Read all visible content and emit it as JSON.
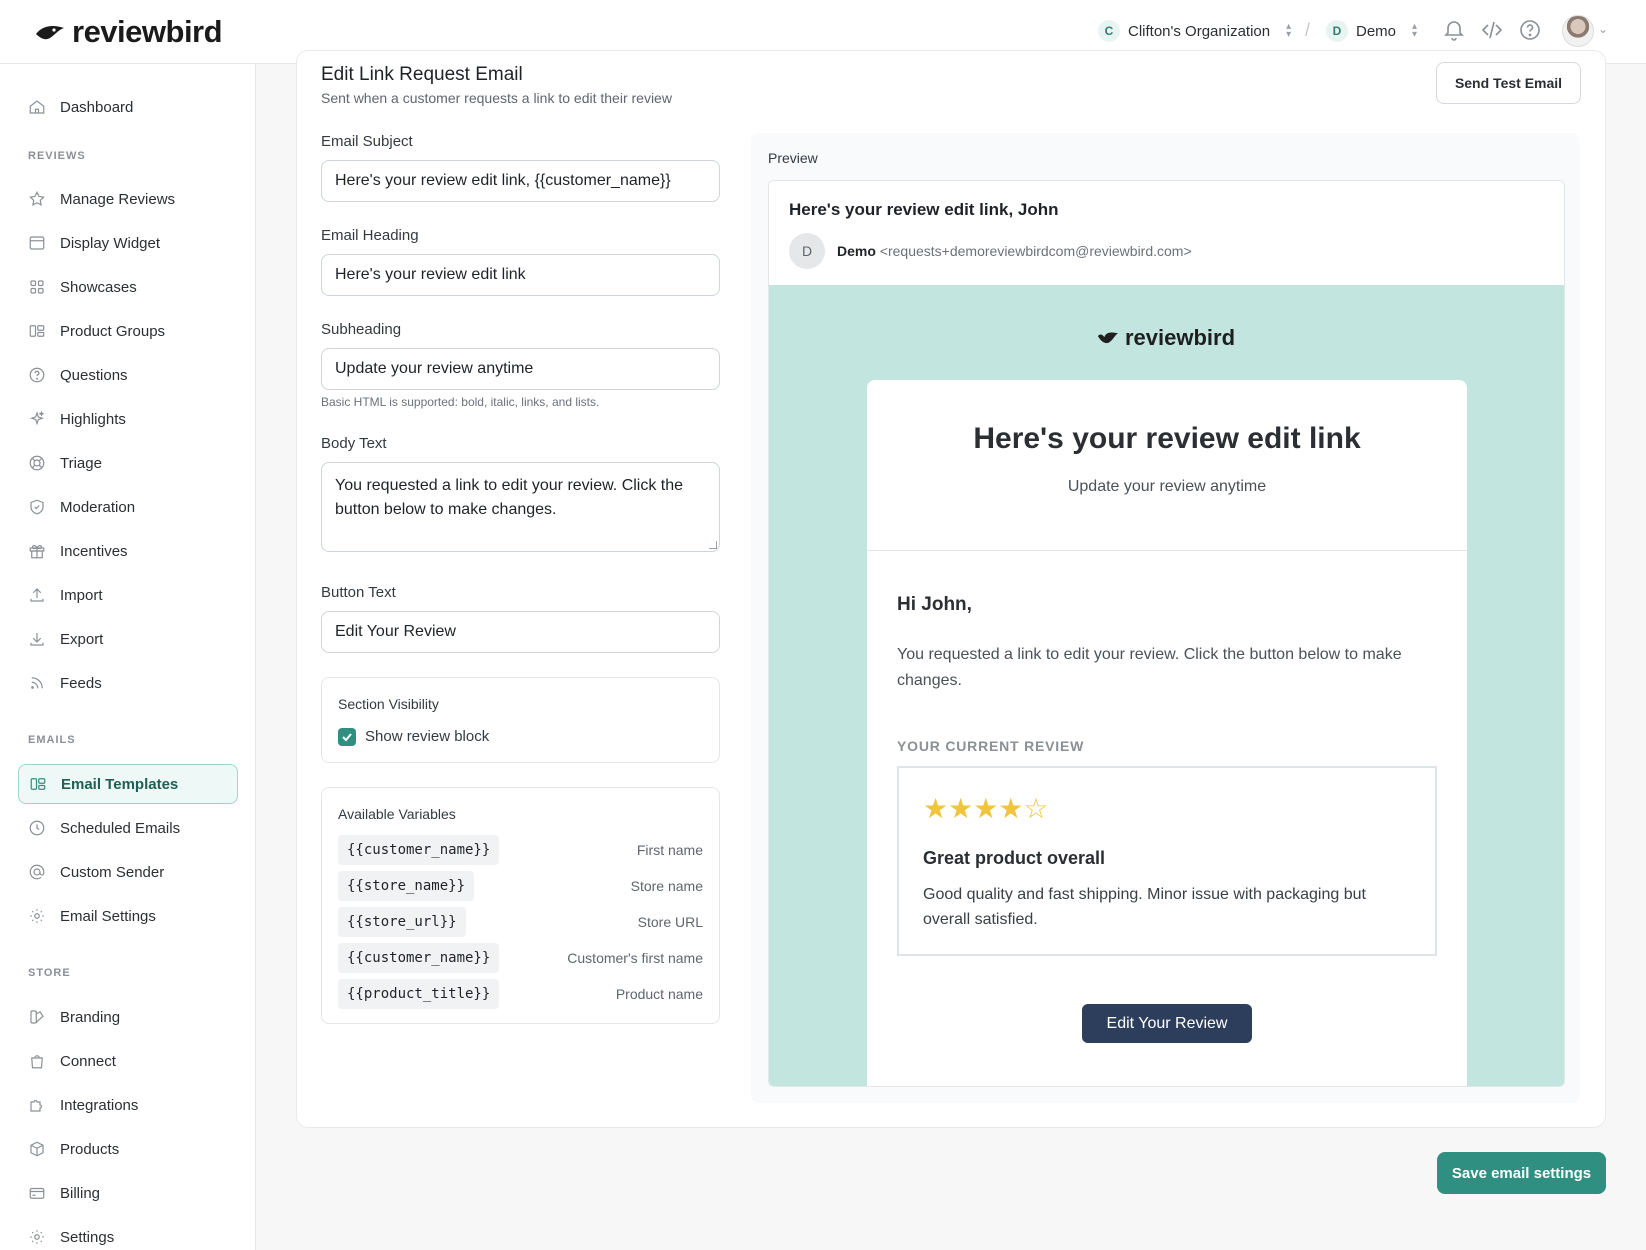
{
  "brand": {
    "name": "reviewbird",
    "accent": "#2f8f80"
  },
  "topbar": {
    "org": {
      "initial": "C",
      "name": "Clifton's Organization"
    },
    "separator": "/",
    "project": {
      "initial": "D",
      "name": "Demo"
    },
    "icons": [
      "bell-icon",
      "code-icon",
      "help-icon"
    ]
  },
  "sidebar": {
    "top": [
      {
        "label": "Dashboard",
        "icon": "home-icon"
      }
    ],
    "sections": {
      "reviews": "REVIEWS",
      "emails": "EMAILS",
      "store": "STORE"
    },
    "reviews": [
      {
        "label": "Manage Reviews",
        "icon": "star-icon"
      },
      {
        "label": "Display Widget",
        "icon": "window-icon"
      },
      {
        "label": "Showcases",
        "icon": "grid-icon"
      },
      {
        "label": "Product Groups",
        "icon": "groups-icon"
      },
      {
        "label": "Questions",
        "icon": "question-icon"
      },
      {
        "label": "Highlights",
        "icon": "sparkle-icon"
      },
      {
        "label": "Triage",
        "icon": "lifebuoy-icon"
      },
      {
        "label": "Moderation",
        "icon": "shield-icon"
      },
      {
        "label": "Incentives",
        "icon": "gift-icon"
      },
      {
        "label": "Import",
        "icon": "upload-icon"
      },
      {
        "label": "Export",
        "icon": "download-icon"
      },
      {
        "label": "Feeds",
        "icon": "rss-icon"
      }
    ],
    "emails": [
      {
        "label": "Email Templates",
        "icon": "template-icon",
        "active": true
      },
      {
        "label": "Scheduled Emails",
        "icon": "clock-icon"
      },
      {
        "label": "Custom Sender",
        "icon": "at-icon"
      },
      {
        "label": "Email Settings",
        "icon": "gear-icon"
      }
    ],
    "store": [
      {
        "label": "Branding",
        "icon": "palette-icon"
      },
      {
        "label": "Connect",
        "icon": "bag-icon"
      },
      {
        "label": "Integrations",
        "icon": "puzzle-icon"
      },
      {
        "label": "Products",
        "icon": "box-icon"
      },
      {
        "label": "Billing",
        "icon": "card-icon"
      },
      {
        "label": "Settings",
        "icon": "gear-icon"
      }
    ]
  },
  "editor": {
    "title": "Edit Link Request Email",
    "subtitle": "Sent when a customer requests a link to edit their review",
    "send_test_label": "Send Test Email",
    "subject_label": "Email Subject",
    "subject_value": "Here's your review edit link, {{customer_name}}",
    "heading_label": "Email Heading",
    "heading_value": "Here's your review edit link",
    "subheading_label": "Subheading",
    "subheading_value": "Update your review anytime",
    "html_hint": "Basic HTML is supported: bold, italic, links, and lists.",
    "body_label": "Body Text",
    "body_value": "You requested a link to edit your review. Click the button below to make changes.",
    "button_label": "Button Text",
    "button_value": "Edit Your Review",
    "visibility_title": "Section Visibility",
    "show_review_block_label": "Show review block",
    "show_review_block": true,
    "variables_title": "Available Variables",
    "variables": [
      {
        "code": "{{customer_name}}",
        "desc": "First name"
      },
      {
        "code": "{{store_name}}",
        "desc": "Store name"
      },
      {
        "code": "{{store_url}}",
        "desc": "Store URL"
      },
      {
        "code": "{{customer_name}}",
        "desc": "Customer's first name"
      },
      {
        "code": "{{product_title}}",
        "desc": "Product name"
      }
    ]
  },
  "preview": {
    "label": "Preview",
    "subject": "Here's your review edit link, John",
    "sender_initial": "D",
    "sender_name": "Demo",
    "sender_address": "<requests+demoreviewbirdcom@reviewbird.com>",
    "logo_text": "reviewbird",
    "heading": "Here's your review edit link",
    "subheading": "Update your review anytime",
    "greeting": "Hi John,",
    "body": "You requested a link to edit your review. Click the button below to make changes.",
    "current_review_label": "YOUR CURRENT REVIEW",
    "rating": 4,
    "rating_max": 5,
    "stars_display": "★★★★☆",
    "review_title": "Great product overall",
    "review_text": "Good quality and fast shipping. Minor issue with packaging but overall satisfied.",
    "button": "Edit Your Review",
    "background_color": "#c2e5e0",
    "button_color": "#2d3e5c"
  },
  "footer": {
    "save_label": "Save email settings"
  }
}
